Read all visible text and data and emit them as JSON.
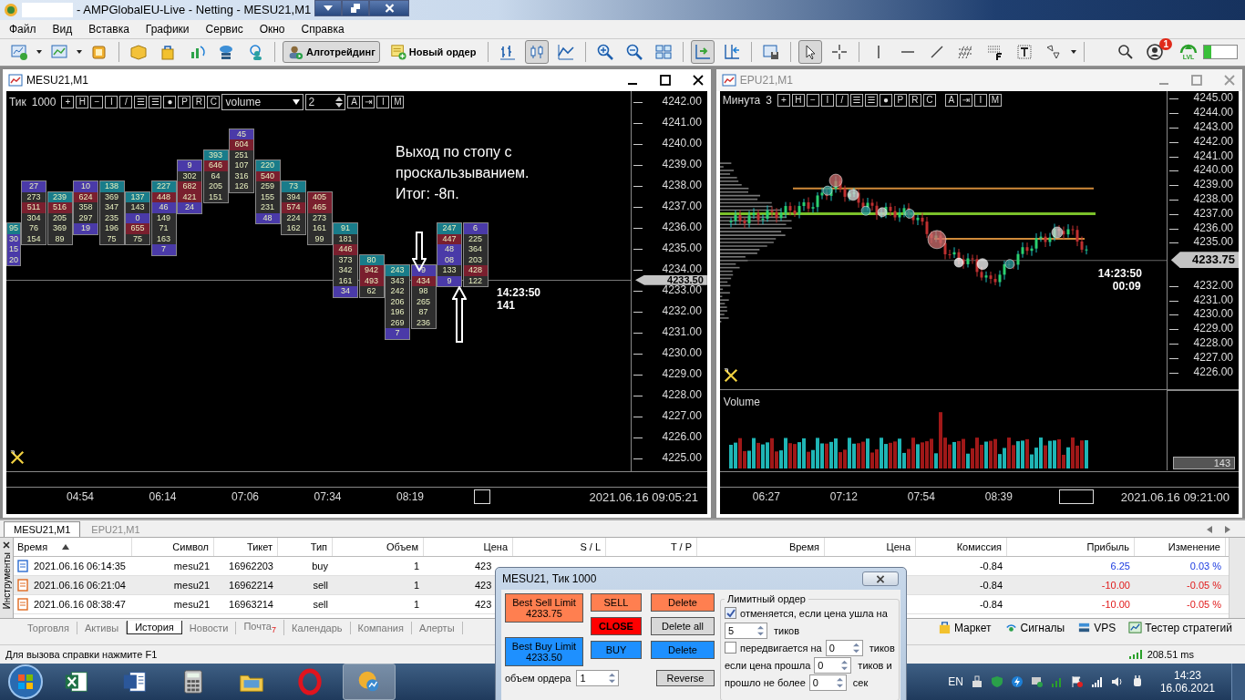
{
  "window": {
    "title": "- AMPGlobalEU-Live - Netting - MESU21,M1"
  },
  "menu": [
    "Файл",
    "Вид",
    "Вставка",
    "Графики",
    "Сервис",
    "Окно",
    "Справка"
  ],
  "toolbar": {
    "algo_trading": {
      "label": "Алготрейдинг",
      "pressed": true
    },
    "new_order": {
      "label": "Новый ордер"
    },
    "chart_types": [
      {
        "selected": false
      },
      {
        "selected": true
      },
      {
        "selected": false
      }
    ],
    "auto_scroll": {
      "pressed": true
    },
    "chart_shift": {
      "pressed": false
    },
    "pointer_tools": [
      {
        "selected": true
      },
      {
        "selected": false
      }
    ],
    "notifications_badge": "1",
    "level_label": "LVL"
  },
  "footprint_chart": {
    "title": "MESU21,M1",
    "active": true,
    "period_label": "Тик",
    "period_value": "1000",
    "tool_buttons_left": [
      "+",
      "H",
      "−",
      "I",
      "/",
      "☰",
      "☰",
      "●",
      "P",
      "R",
      "C"
    ],
    "select": {
      "value": "volume"
    },
    "spin": {
      "value": "2"
    },
    "tool_buttons_right": [
      "A",
      "⇥",
      "I",
      "M"
    ],
    "price_labels": [
      "4242.00",
      "4241.00",
      "4240.00",
      "4239.00",
      "4238.00",
      "4237.00",
      "4236.00",
      "4235.00",
      "4234.00",
      "4233.00",
      "4232.00",
      "4231.00",
      "4230.00",
      "4229.00",
      "4228.00",
      "4227.00",
      "4226.00",
      "4225.00"
    ],
    "current_price": "4233.50",
    "annotation": "Выход по стопу с\nпроскальзыванием.\nИтог: -8п.",
    "bar_time": "14:23:50",
    "bar_count": "141",
    "time_labels": [
      "04:54",
      "06:14",
      "07:06",
      "07:34",
      "08:19"
    ],
    "date_label": "2021.06.16 09:05:21",
    "columns": [
      {
        "cells": [
          "95",
          "30",
          "15",
          "20"
        ]
      },
      {
        "cells": [
          "27",
          "273",
          "511",
          "304",
          "76",
          "154"
        ]
      },
      {
        "cells": [
          "239",
          "516",
          "205",
          "369",
          "89"
        ]
      },
      {
        "cells": [
          "10",
          "624",
          "358",
          "297",
          "19"
        ]
      },
      {
        "cells": [
          "138",
          "369",
          "347",
          "235",
          "196",
          "75"
        ]
      },
      {
        "cells": [
          "137",
          "143",
          "0",
          "655",
          "75"
        ]
      },
      {
        "cells": [
          "227",
          "448",
          "46",
          "149",
          "71",
          "163",
          "7"
        ]
      },
      {
        "cells": [
          "9",
          "302",
          "682",
          "421",
          "24"
        ]
      },
      {
        "cells": [
          "393",
          "646",
          "64",
          "205",
          "151"
        ]
      },
      {
        "cells": [
          "45",
          "604",
          "251",
          "107",
          "316",
          "126"
        ]
      },
      {
        "cells": [
          "220",
          "540",
          "259",
          "155",
          "231",
          "48"
        ]
      },
      {
        "cells": [
          "73",
          "394",
          "574",
          "224",
          "162"
        ]
      },
      {
        "cells": [
          "405",
          "465",
          "273",
          "161",
          "99"
        ]
      },
      {
        "cells": [
          "91",
          "181",
          "446",
          "373",
          "342",
          "161",
          "34"
        ]
      },
      {
        "cells": [
          "80",
          "942",
          "493",
          "62"
        ]
      },
      {
        "cells": [
          "243",
          "343",
          "242",
          "206",
          "196",
          "269",
          "7"
        ]
      },
      {
        "cells": [
          "9",
          "434",
          "98",
          "265",
          "87",
          "236"
        ]
      },
      {
        "cells": [
          "247",
          "447",
          "48",
          "08",
          "133",
          "9"
        ]
      },
      {
        "cells": [
          "6",
          "225",
          "364",
          "203",
          "428",
          "122"
        ]
      }
    ]
  },
  "candle_chart": {
    "title": "EPU21,M1",
    "active": false,
    "period_label": "Минута",
    "period_value": "3",
    "tool_buttons_left": [
      "+",
      "H",
      "−",
      "I",
      "/",
      "☰",
      "☰",
      "●",
      "P",
      "R",
      "C"
    ],
    "tool_buttons_right": [
      "A",
      "⇥",
      "I",
      "M"
    ],
    "price_labels_upper": [
      "4245.00",
      "4244.00",
      "4243.00",
      "4242.00",
      "4241.00",
      "4240.00",
      "4239.00",
      "4238.00",
      "4237.00",
      "4236.00",
      "4235.00"
    ],
    "price_labels_lower": [
      "4232.00",
      "4231.00",
      "4230.00",
      "4229.00",
      "4228.00",
      "4227.00",
      "4226.00"
    ],
    "current_price": "4233.75",
    "bar_time": "14:23:50",
    "bar_remaining": "00:09",
    "volume": {
      "title": "Volume",
      "reading": "143"
    },
    "time_labels": [
      "06:27",
      "07:12",
      "07:54",
      "08:39"
    ],
    "date_label": "2021.06.16 09:21:00"
  },
  "terminal": {
    "chart_tabs": [
      {
        "label": "MESU21,M1",
        "selected": true
      },
      {
        "label": "EPU21,M1",
        "selected": false
      }
    ],
    "side_label": "Инструменты",
    "columns": [
      {
        "label": "Время",
        "sorted": true
      },
      {
        "label": "Символ",
        "sorted": false
      },
      {
        "label": "Тикет",
        "sorted": false
      },
      {
        "label": "Тип",
        "sorted": false
      },
      {
        "label": "Объем",
        "sorted": false
      },
      {
        "label": "Цена",
        "sorted": false
      },
      {
        "label": "S / L",
        "sorted": false
      },
      {
        "label": "T / P",
        "sorted": false
      },
      {
        "label": "Время",
        "sorted": false
      },
      {
        "label": "Цена",
        "sorted": false
      },
      {
        "label": "Комиссия",
        "sorted": false
      },
      {
        "label": "Прибыль",
        "sorted": false
      },
      {
        "label": "Изменение",
        "sorted": false
      }
    ],
    "rows": [
      {
        "kind": "buy",
        "time": "2021.06.16 06:14:35",
        "symbol": "mesu21",
        "ticket": "16962203",
        "type": "buy",
        "volume": "1",
        "price": "423",
        "commission": "-0.84",
        "profit": "6.25",
        "change": "0.03 %"
      },
      {
        "kind": "sell",
        "time": "2021.06.16 06:21:04",
        "symbol": "mesu21",
        "ticket": "16962214",
        "type": "sell",
        "volume": "1",
        "price": "423",
        "commission": "-0.84",
        "profit": "-10.00",
        "change": "-0.05 %"
      },
      {
        "kind": "sell",
        "time": "2021.06.16 08:38:47",
        "symbol": "mesu21",
        "ticket": "16963214",
        "type": "sell",
        "volume": "1",
        "price": "423",
        "commission": "-0.84",
        "profit": "-10.00",
        "change": "-0.05 %"
      }
    ],
    "bottom_tabs": [
      {
        "label": "Торговля",
        "selected": false
      },
      {
        "label": "Активы",
        "selected": false
      },
      {
        "label": "История",
        "selected": true
      },
      {
        "label": "Новости",
        "selected": false
      },
      {
        "label": "Почта",
        "selected": false,
        "badge": "7"
      },
      {
        "label": "Календарь",
        "selected": false
      },
      {
        "label": "Компания",
        "selected": false
      },
      {
        "label": "Алерты",
        "selected": false
      }
    ],
    "links": [
      {
        "kind": "market",
        "label": "Маркет"
      },
      {
        "kind": "signals",
        "label": "Сигналы"
      },
      {
        "kind": "vps",
        "label": "VPS"
      },
      {
        "kind": "tester",
        "label": "Тестер стратегий"
      }
    ]
  },
  "status_bar": {
    "help": "Для вызова справки нажмите F1",
    "ping": "208.51 ms"
  },
  "taskbar": {
    "apps": [
      {
        "kind": "spreadsheet",
        "selected": false
      },
      {
        "kind": "document",
        "selected": false
      },
      {
        "kind": "calculator",
        "selected": false
      },
      {
        "kind": "folder",
        "selected": false
      },
      {
        "kind": "browser",
        "selected": false
      },
      {
        "kind": "trading",
        "selected": true
      }
    ],
    "language": "EN",
    "time": "14:23",
    "date": "16.06.2021"
  },
  "dialog": {
    "title": "MESU21, Тик  1000",
    "best_sell": {
      "label": "Best Sell Limit",
      "price": "4233.75"
    },
    "best_buy": {
      "label": "Best Buy Limit",
      "price": "4233.50"
    },
    "buttons": [
      {
        "label": "SELL",
        "kind": "sell"
      },
      {
        "label": "Delete",
        "kind": "sell"
      },
      {
        "label": "CLOSE",
        "kind": "close"
      },
      {
        "label": "Delete all",
        "kind": "neutral"
      },
      {
        "label": "BUY",
        "kind": "buy"
      },
      {
        "label": "Delete",
        "kind": "buy"
      }
    ],
    "volume_label": "объем ордера",
    "volume_value": "1",
    "reverse": "Reverse",
    "limit_group": {
      "title": "Лимитный ордер",
      "cancel": {
        "checked": true,
        "label": "отменяется, если цена ушла на",
        "value": "5",
        "unit": "тиков"
      },
      "move": {
        "checked": false,
        "label": "передвигается на",
        "value": "0",
        "unit": "тиков"
      },
      "if_passed": {
        "label": "если цена прошла",
        "value": "0",
        "unit": "тиков и"
      },
      "time_limit": {
        "label": "прошло не более",
        "value": "0",
        "unit": "сек"
      }
    }
  }
}
